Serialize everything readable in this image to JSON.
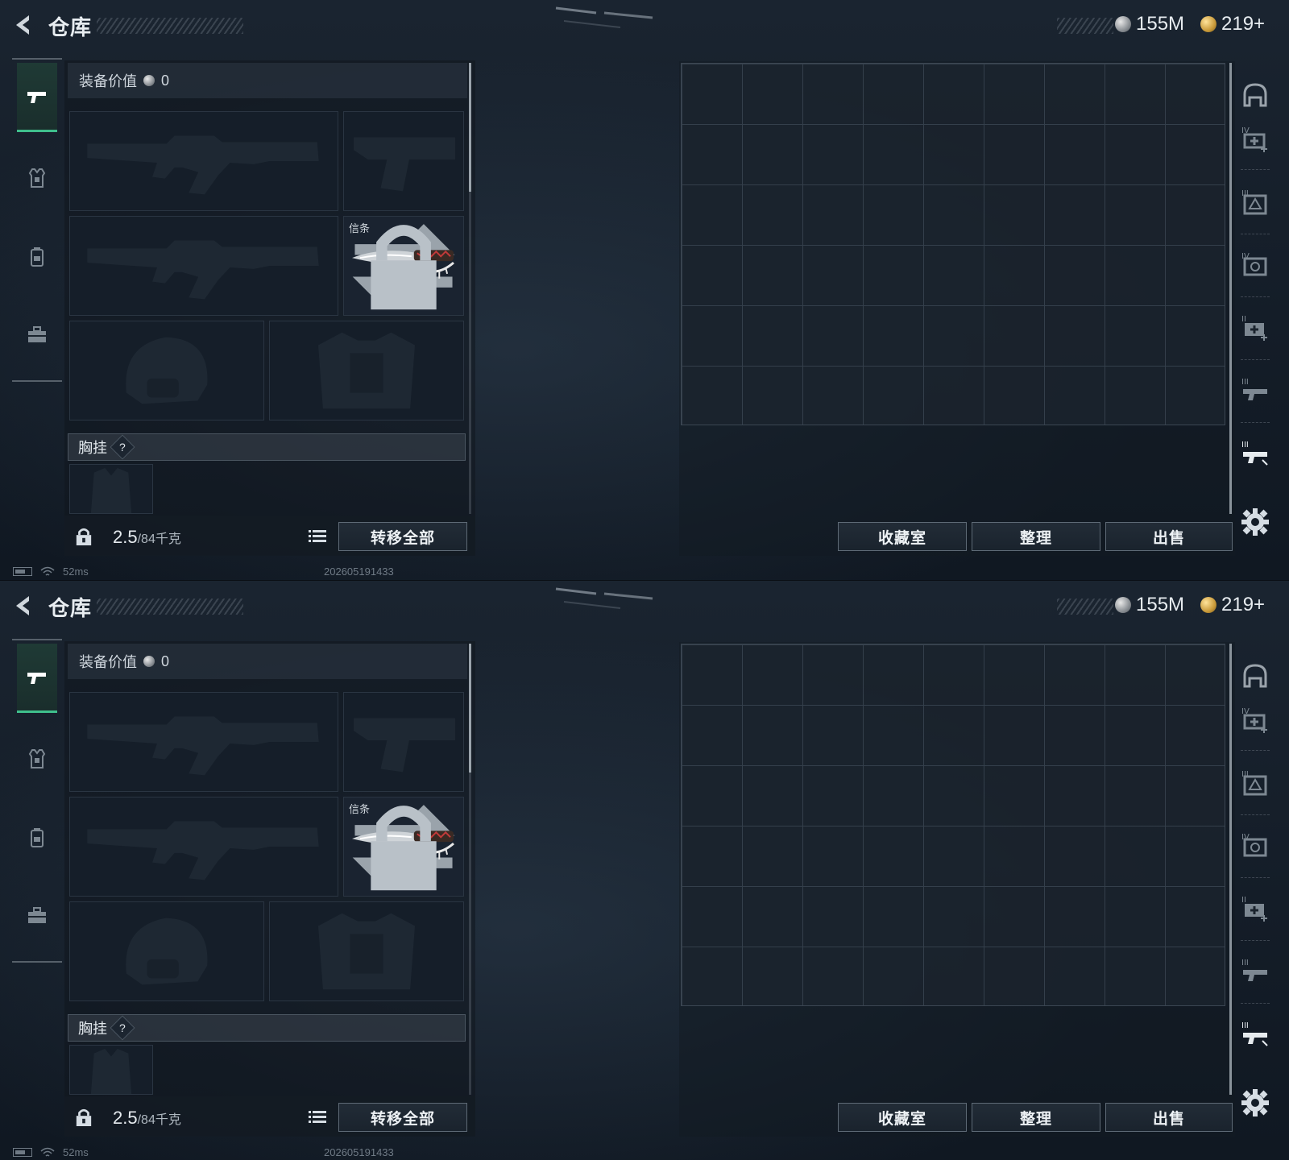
{
  "header": {
    "title": "仓库",
    "silver": "155M",
    "gold": "219+"
  },
  "loadout": {
    "value_label": "装备价值",
    "value": "0",
    "melee_label": "信条",
    "chest_label": "胸挂",
    "help": "?",
    "weight_current": "2.5",
    "weight_max": "/84千克",
    "transfer_all": "转移全部"
  },
  "stash": {
    "collection_button": "收藏室",
    "sort_button": "整理",
    "sell_button": "出售"
  },
  "right_tabs": [
    "helmet-tab",
    "IV-medkit-tab",
    "III-armor-tab",
    "IV-armor-tab",
    "II-medkit-tab",
    "III-gun-tab",
    "III-gun-tab-active"
  ],
  "status": {
    "ping": "52ms",
    "build": "202605191433"
  },
  "colors": {
    "accent_green": "#3fbf8c",
    "background": "#141d28",
    "grid_line": "#343f4b"
  }
}
